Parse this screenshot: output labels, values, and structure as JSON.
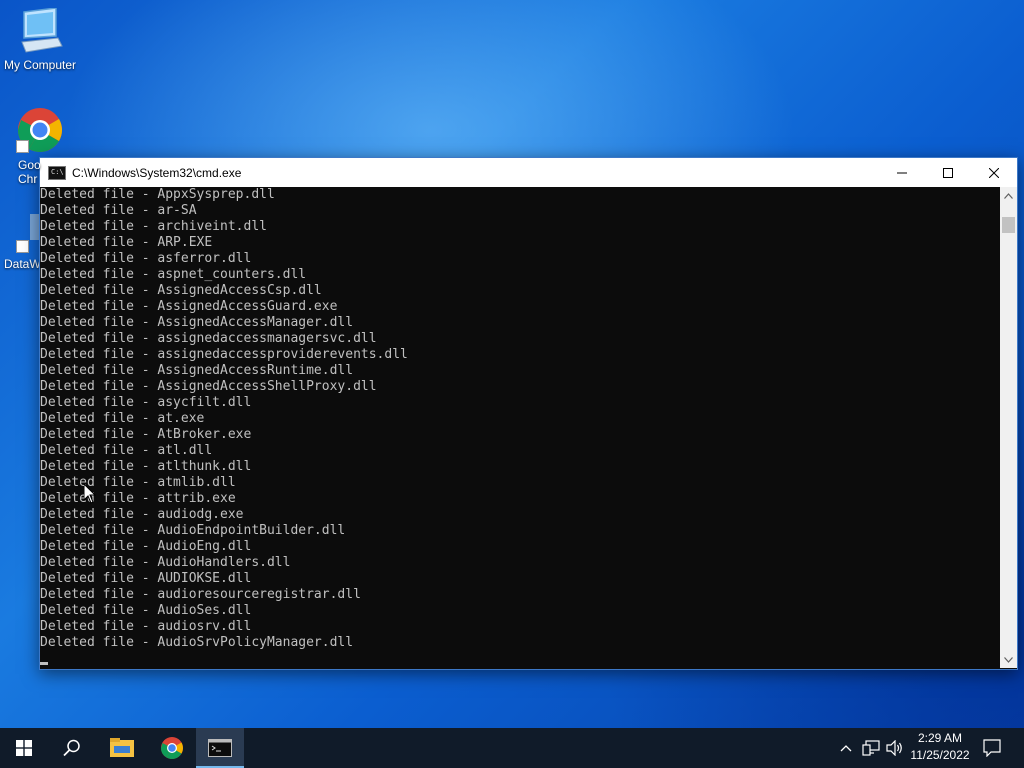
{
  "desktop": {
    "icons": [
      {
        "label": "My Computer"
      },
      {
        "label": "Google Chrome",
        "partial": "Goo\nChr"
      },
      {
        "label": "DataW"
      }
    ]
  },
  "window": {
    "title": "C:\\Windows\\System32\\cmd.exe",
    "app_icon_text": "C:\\",
    "lines": [
      "Deleted file - AppxSysprep.dll",
      "Deleted file - ar-SA",
      "Deleted file - archiveint.dll",
      "Deleted file - ARP.EXE",
      "Deleted file - asferror.dll",
      "Deleted file - aspnet_counters.dll",
      "Deleted file - AssignedAccessCsp.dll",
      "Deleted file - AssignedAccessGuard.exe",
      "Deleted file - AssignedAccessManager.dll",
      "Deleted file - assignedaccessmanagersvc.dll",
      "Deleted file - assignedaccessproviderevents.dll",
      "Deleted file - AssignedAccessRuntime.dll",
      "Deleted file - AssignedAccessShellProxy.dll",
      "Deleted file - asycfilt.dll",
      "Deleted file - at.exe",
      "Deleted file - AtBroker.exe",
      "Deleted file - atl.dll",
      "Deleted file - atlthunk.dll",
      "Deleted file - atmlib.dll",
      "Deleted file - attrib.exe",
      "Deleted file - audiodg.exe",
      "Deleted file - AudioEndpointBuilder.dll",
      "Deleted file - AudioEng.dll",
      "Deleted file - AudioHandlers.dll",
      "Deleted file - AUDIOKSE.dll",
      "Deleted file - audioresourceregistrar.dll",
      "Deleted file - AudioSes.dll",
      "Deleted file - audiosrv.dll",
      "Deleted file - AudioSrvPolicyManager.dll"
    ]
  },
  "taskbar": {
    "clock_time": "2:29 AM",
    "clock_date": "11/25/2022"
  },
  "colors": {
    "console_bg": "#0c0c0c",
    "console_fg": "#c0c0c0",
    "taskbar_bg": "#101b29",
    "accent": "#76b9ed"
  }
}
